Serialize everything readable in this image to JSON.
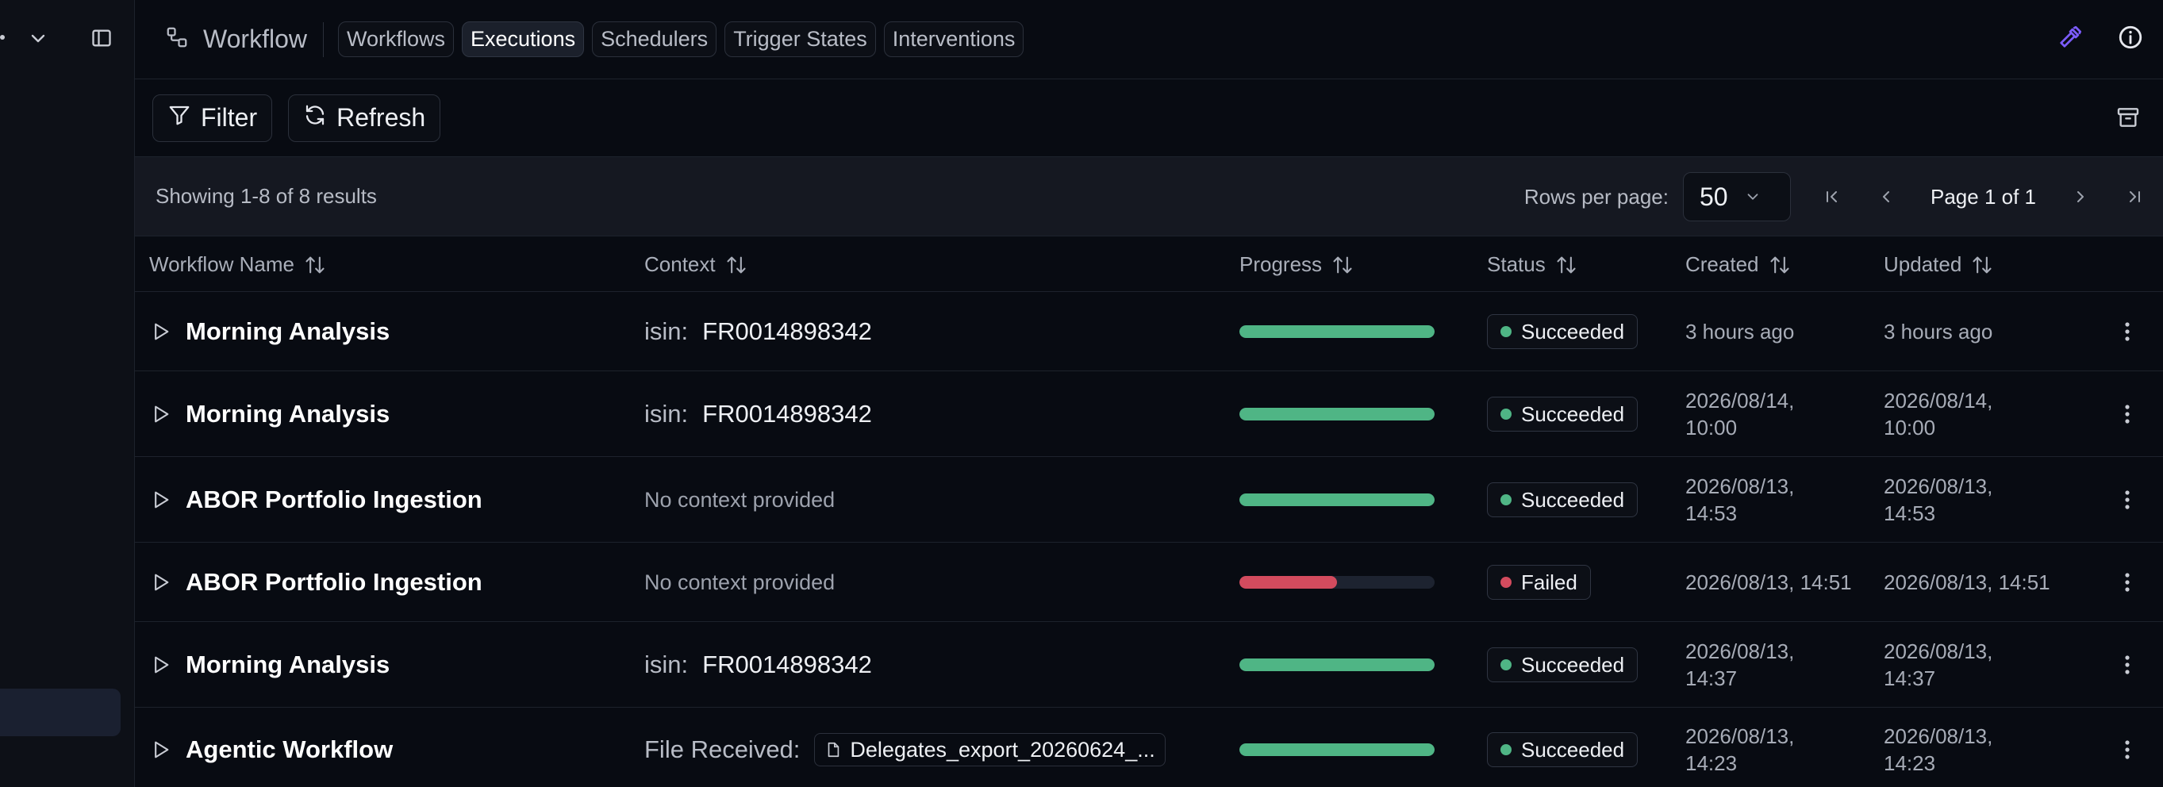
{
  "app": {
    "title": "Workflow"
  },
  "tabs": [
    {
      "label": "Workflows",
      "active": false
    },
    {
      "label": "Executions",
      "active": true
    },
    {
      "label": "Schedulers",
      "active": false
    },
    {
      "label": "Trigger States",
      "active": false
    },
    {
      "label": "Interventions",
      "active": false
    }
  ],
  "toolbar": {
    "filter_label": "Filter",
    "refresh_label": "Refresh"
  },
  "pagination": {
    "showing": "Showing 1-8 of 8 results",
    "rows_per_page_label": "Rows per page:",
    "rows_per_page_value": "50",
    "page_label": "Page 1 of 1"
  },
  "columns": {
    "workflow_name": "Workflow Name",
    "context": "Context",
    "progress": "Progress",
    "status": "Status",
    "created": "Created",
    "updated": "Updated"
  },
  "colors": {
    "success": "#4fb585",
    "failed": "#d34b5e",
    "accent": "#7c5cff"
  },
  "rows": [
    {
      "name": "Morning Analysis",
      "context_key": "isin:",
      "context_value": "FR0014898342",
      "context_type": "kv",
      "progress": 1.0,
      "status": "Succeeded",
      "created_1": "3 hours ago",
      "created_2": "",
      "updated_1": "3 hours ago",
      "updated_2": ""
    },
    {
      "name": "Morning Analysis",
      "context_key": "isin:",
      "context_value": "FR0014898342",
      "context_type": "kv",
      "progress": 1.0,
      "status": "Succeeded",
      "created_1": "2026/08/14,",
      "created_2": "10:00",
      "updated_1": "2026/08/14,",
      "updated_2": "10:00"
    },
    {
      "name": "ABOR Portfolio Ingestion",
      "context_key": "",
      "context_value": "No context provided",
      "context_type": "none",
      "progress": 1.0,
      "status": "Succeeded",
      "created_1": "2026/08/13,",
      "created_2": "14:53",
      "updated_1": "2026/08/13,",
      "updated_2": "14:53"
    },
    {
      "name": "ABOR Portfolio Ingestion",
      "context_key": "",
      "context_value": "No context provided",
      "context_type": "none",
      "progress": 0.5,
      "status": "Failed",
      "created_1": "2026/08/13, 14:51",
      "created_2": "",
      "updated_1": "2026/08/13, 14:51",
      "updated_2": ""
    },
    {
      "name": "Morning Analysis",
      "context_key": "isin:",
      "context_value": "FR0014898342",
      "context_type": "kv",
      "progress": 1.0,
      "status": "Succeeded",
      "created_1": "2026/08/13,",
      "created_2": "14:37",
      "updated_1": "2026/08/13,",
      "updated_2": "14:37"
    },
    {
      "name": "Agentic Workflow",
      "context_key": "File Received:",
      "context_value": "Delegates_export_20260624_...",
      "context_type": "file",
      "progress": 1.0,
      "status": "Succeeded",
      "created_1": "2026/08/13,",
      "created_2": "14:23",
      "updated_1": "2026/08/13,",
      "updated_2": "14:23"
    }
  ]
}
